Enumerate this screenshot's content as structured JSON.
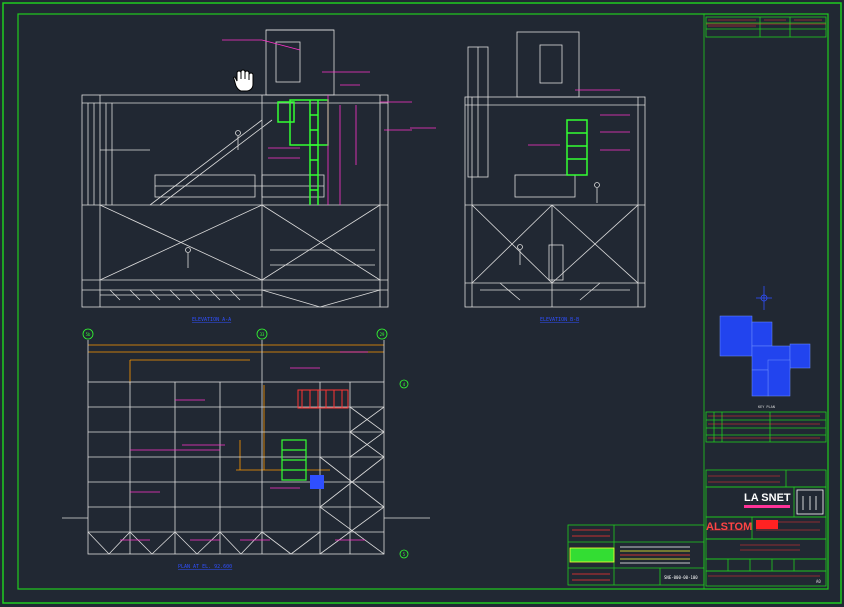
{
  "drawing": {
    "background_color": "#212833",
    "border_color": "#22cc22",
    "line_color": "#e6e6e6",
    "annotation_color": "#ff33cc",
    "highlight_color": "#33ff33",
    "dimension_color": "#ff9900",
    "legend_color": "#2f4fff"
  },
  "grid_bubbles": [
    "5b",
    "33",
    "29"
  ],
  "row_bubbles": [
    "4",
    "5"
  ],
  "views": {
    "left_elevation_title": "ELEVATION A-A",
    "right_elevation_title": "ELEVATION B-B",
    "plan_title": "PLAN AT EL. 92.600"
  },
  "title_block": {
    "company_1": "LA SNET",
    "company_2": "ALSTOM",
    "legend_caption": "KEY PLAN",
    "drawing_number": "SNE-000-00-100",
    "sheet_label": "A0"
  },
  "cursor": {
    "icon": "hand-pan-icon"
  }
}
